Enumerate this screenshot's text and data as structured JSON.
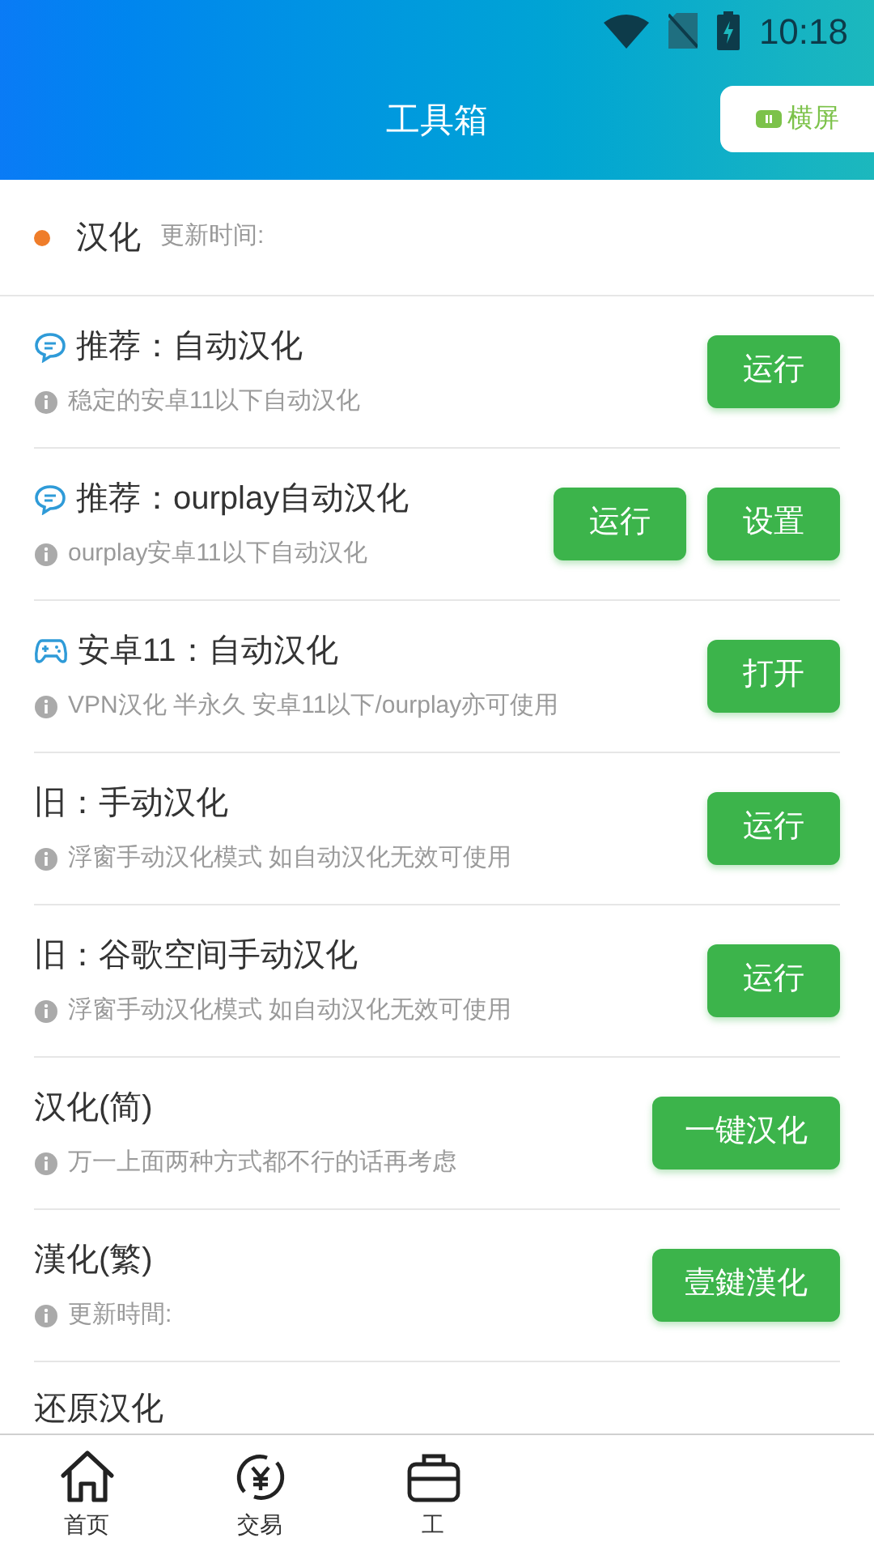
{
  "status_bar": {
    "time": "10:18"
  },
  "header": {
    "title": "工具箱",
    "landscape_button": "横屏"
  },
  "section": {
    "title": "汉化",
    "subtitle": "更新时间:"
  },
  "rows": [
    {
      "kind": "chat",
      "title": "推荐：自动汉化",
      "note": "稳定的安卓11以下自动汉化",
      "buttons": [
        "运行"
      ]
    },
    {
      "kind": "chat",
      "title": "推荐：ourplay自动汉化",
      "note": "ourplay安卓11以下自动汉化",
      "buttons": [
        "运行",
        "设置"
      ]
    },
    {
      "kind": "game",
      "title": "安卓11：自动汉化",
      "note": "VPN汉化 半永久 安卓11以下/ourplay亦可使用",
      "buttons": [
        "打开"
      ]
    },
    {
      "kind": "plain",
      "title": "旧：手动汉化",
      "note": "浮窗手动汉化模式 如自动汉化无效可使用",
      "buttons": [
        "运行"
      ]
    },
    {
      "kind": "plain",
      "title": "旧：谷歌空间手动汉化",
      "note": "浮窗手动汉化模式 如自动汉化无效可使用",
      "buttons": [
        "运行"
      ]
    },
    {
      "kind": "plain",
      "title": "汉化(简)",
      "note": "万一上面两种方式都不行的话再考虑",
      "buttons": [
        "一键汉化"
      ]
    },
    {
      "kind": "plain",
      "title": "漢化(繁)",
      "note": "更新時間:",
      "buttons": [
        "壹鍵漢化"
      ]
    },
    {
      "kind": "plain",
      "title": "还原汉化"
    }
  ],
  "bottom_nav": [
    {
      "label": "首页"
    },
    {
      "label": "交易"
    },
    {
      "label": "工"
    }
  ]
}
